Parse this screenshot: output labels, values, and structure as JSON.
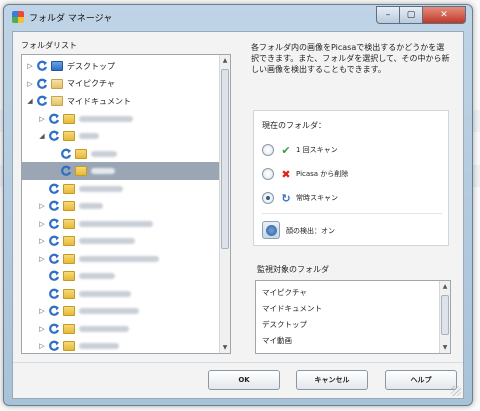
{
  "window": {
    "title": "フォルダ マネージャ"
  },
  "folder_list": {
    "label": "フォルダリスト",
    "items": [
      {
        "label": "デスクトップ",
        "arrow": "▷",
        "icon": "blue",
        "indent": 0
      },
      {
        "label": "マイピクチャ",
        "arrow": "▷",
        "icon": "doc",
        "indent": 0
      },
      {
        "label": "マイドキュメント",
        "arrow": "◢",
        "icon": "doc",
        "indent": 0
      },
      {
        "label": "",
        "arrow": "▷",
        "icon": "yellow",
        "indent": 1,
        "blur": 54
      },
      {
        "label": "",
        "arrow": "◢",
        "icon": "yellow",
        "indent": 1,
        "blur": 20
      },
      {
        "label": "",
        "arrow": "",
        "icon": "yellow",
        "indent": 2,
        "blur": 26
      },
      {
        "label": "",
        "arrow": "",
        "icon": "yellow",
        "indent": 2,
        "blur": 24,
        "selected": true
      },
      {
        "label": "",
        "arrow": "",
        "icon": "yellow",
        "indent": 1,
        "blur": 44
      },
      {
        "label": "",
        "arrow": "▷",
        "icon": "yellow",
        "indent": 1,
        "blur": 24
      },
      {
        "label": "",
        "arrow": "▷",
        "icon": "yellow",
        "indent": 1,
        "blur": 74
      },
      {
        "label": "",
        "arrow": "▷",
        "icon": "yellow",
        "indent": 1,
        "blur": 56
      },
      {
        "label": "",
        "arrow": "▷",
        "icon": "yellow",
        "indent": 1,
        "blur": 80
      },
      {
        "label": "",
        "arrow": "",
        "icon": "yellow",
        "indent": 1,
        "blur": 36
      },
      {
        "label": "",
        "arrow": "",
        "icon": "yellow",
        "indent": 1,
        "blur": 52
      },
      {
        "label": "",
        "arrow": "▷",
        "icon": "yellow",
        "indent": 1,
        "blur": 60
      },
      {
        "label": "",
        "arrow": "▷",
        "icon": "yellow",
        "indent": 1,
        "blur": 50
      },
      {
        "label": "",
        "arrow": "▷",
        "icon": "yellow",
        "indent": 1,
        "blur": 40
      }
    ]
  },
  "description": "各フォルダ内の画像をPicasaで検出するかどうかを選択できます。また、フォルダを選択して、その中から新しい画像を検出することもできます。",
  "current_folder": {
    "title": "現在のフォルダ：",
    "options": [
      {
        "label": "1 回スキャン",
        "icon": "check-icon"
      },
      {
        "label": "Picasa から削除",
        "icon": "x-icon"
      },
      {
        "label": "常時スキャン",
        "icon": "refresh-icon",
        "checked": true
      }
    ],
    "face_detection": "顔の検出：オン"
  },
  "watched": {
    "label": "監視対象のフォルダ",
    "items": [
      "マイピクチャ",
      "マイドキュメント",
      "デスクトップ",
      "マイ動画"
    ]
  },
  "buttons": {
    "ok": "OK",
    "cancel": "キャンセル",
    "help": "ヘルプ"
  }
}
